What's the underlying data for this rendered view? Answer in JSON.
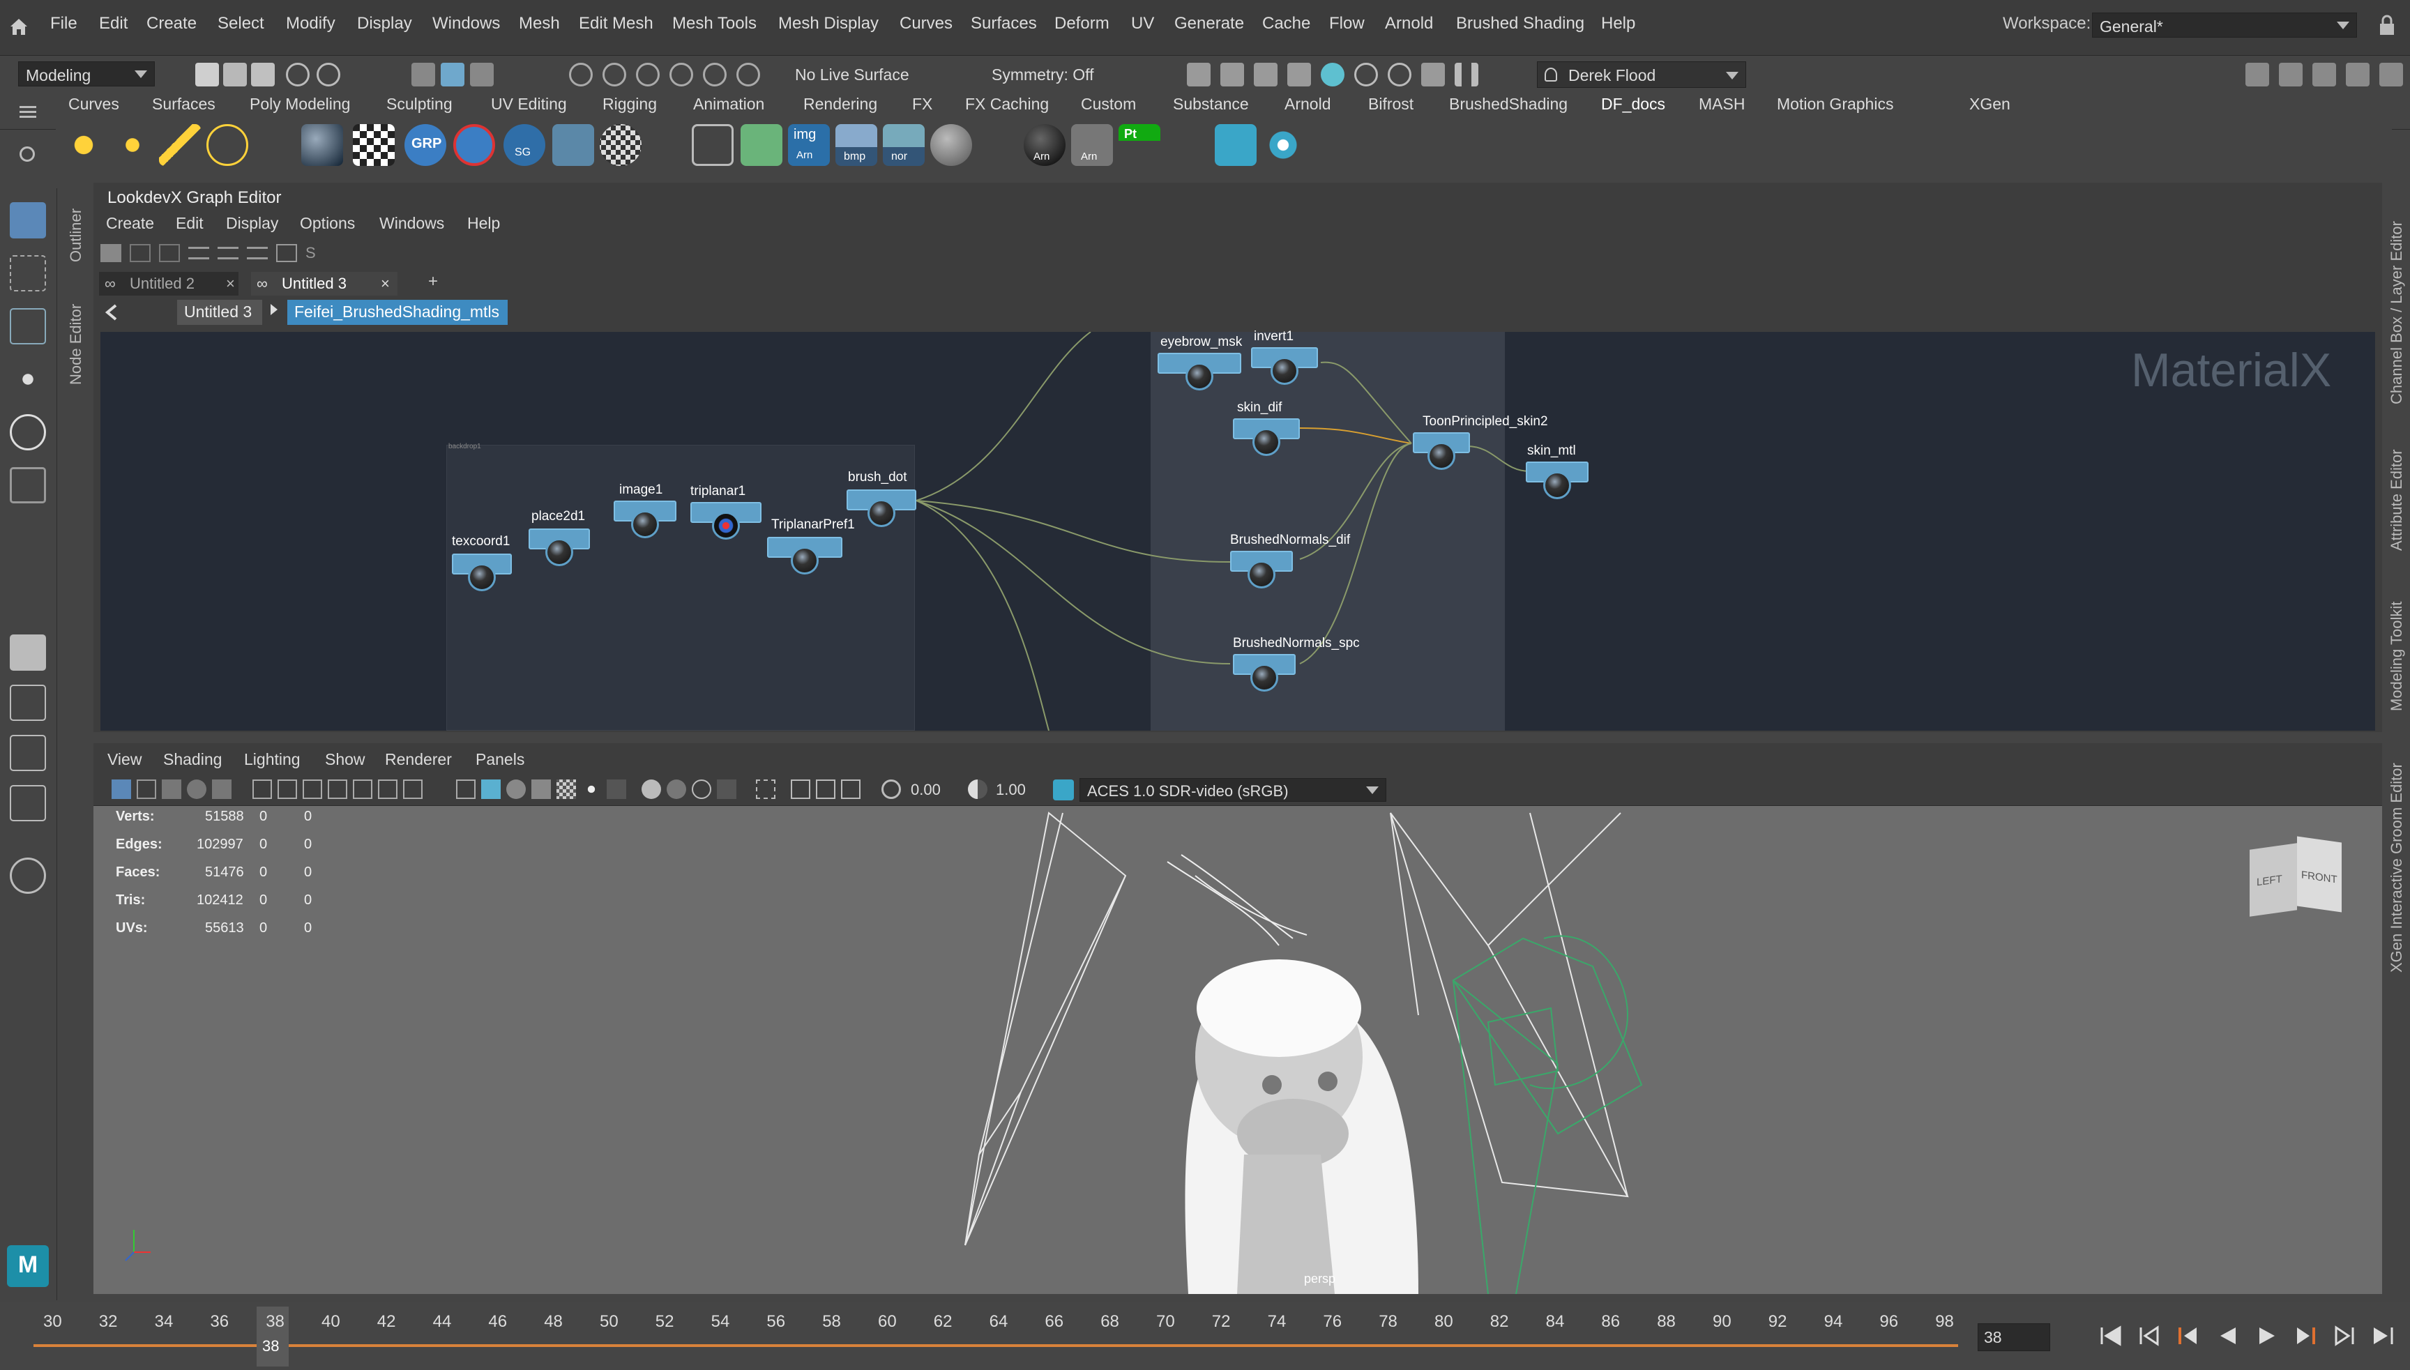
{
  "menubar": {
    "items": [
      "File",
      "Edit",
      "Create",
      "Select",
      "Modify",
      "Display",
      "Windows",
      "Mesh",
      "Edit Mesh",
      "Mesh Tools",
      "Mesh Display",
      "Curves",
      "Surfaces",
      "Deform",
      "UV",
      "Generate",
      "Cache",
      "Flow",
      "Arnold",
      "Brushed Shading",
      "Help"
    ],
    "workspace_label": "Workspace:",
    "workspace_value": "General*"
  },
  "statusline": {
    "mode": "Modeling",
    "live_surface": "No Live Surface",
    "symmetry": "Symmetry: Off",
    "user": "Derek Flood"
  },
  "shelf": {
    "tabs": [
      "Curves",
      "Surfaces",
      "Poly Modeling",
      "Sculpting",
      "UV Editing",
      "Rigging",
      "Animation",
      "Rendering",
      "FX",
      "FX Caching",
      "Custom",
      "Substance",
      "Arnold",
      "Bifrost",
      "BrushedShading",
      "DF_docs",
      "MASH",
      "Motion Graphics",
      "XGen"
    ],
    "active_tab": "DF_docs",
    "icon_labels": {
      "img": "img",
      "arn": "Arn",
      "bmp": "bmp",
      "nor": "nor",
      "arn2": "Arn",
      "arn3": "Arn",
      "pt": "Pt",
      "grp": "GRP",
      "sg": "SG"
    }
  },
  "side_tabs_left": [
    "Outliner",
    "Node Editor"
  ],
  "side_tabs_right": [
    "Channel Box / Layer Editor",
    "Attribute Editor",
    "Modeling Toolkit",
    "XGen Interactive Groom Editor"
  ],
  "graph_editor": {
    "title": "LookdevX Graph Editor",
    "menu": [
      "Create",
      "Edit",
      "Display",
      "Options",
      "Windows",
      "Help"
    ],
    "tabs": [
      {
        "label": "Untitled 2"
      },
      {
        "label": "Untitled 3"
      }
    ],
    "add_tab": "+",
    "breadcrumb": [
      "Untitled 3",
      "Feifei_BrushedShading_mtls"
    ],
    "watermark": "MaterialX",
    "backdrop_label": "backdrop1",
    "nodes": {
      "texcoord1": "texcoord1",
      "place2d1": "place2d1",
      "image1": "image1",
      "triplanar1": "triplanar1",
      "triplanarpref1": "TriplanarPref1",
      "brush_dot": "brush_dot",
      "eyebrow_msk": "eyebrow_msk",
      "invert1": "invert1",
      "skin_dif": "skin_dif",
      "toon": "ToonPrincipled_skin2",
      "skin_mtl": "skin_mtl",
      "bn_dif": "BrushedNormals_dif",
      "bn_spc": "BrushedNormals_spc"
    }
  },
  "viewport": {
    "menu": [
      "View",
      "Shading",
      "Lighting",
      "Show",
      "Renderer",
      "Panels"
    ],
    "gamma": "0.00",
    "exposure": "1.00",
    "colorspace": "ACES 1.0 SDR-video (sRGB)",
    "hud": [
      {
        "label": "Verts:",
        "v1": "51588",
        "v2": "0",
        "v3": "0"
      },
      {
        "label": "Edges:",
        "v1": "102997",
        "v2": "0",
        "v3": "0"
      },
      {
        "label": "Faces:",
        "v1": "51476",
        "v2": "0",
        "v3": "0"
      },
      {
        "label": "Tris:",
        "v1": "102412",
        "v2": "0",
        "v3": "0"
      },
      {
        "label": "UVs:",
        "v1": "55613",
        "v2": "0",
        "v3": "0"
      }
    ],
    "camera": "persp",
    "cube_left": "LEFT",
    "cube_front": "FRONT"
  },
  "timeline": {
    "ticks": [
      "30",
      "32",
      "34",
      "36",
      "38",
      "40",
      "42",
      "44",
      "46",
      "48",
      "50",
      "52",
      "54",
      "56",
      "58",
      "60",
      "62",
      "64",
      "66",
      "68",
      "70",
      "72",
      "74",
      "76",
      "78",
      "80",
      "82",
      "84",
      "86",
      "88",
      "90",
      "92",
      "94",
      "96",
      "98"
    ],
    "current_frame": "38",
    "current_field": "38"
  },
  "colors": {
    "accent": "#5fa0c8",
    "bg": "#444444",
    "canvas": "#252b36",
    "viewport": "#6d6d6d"
  }
}
